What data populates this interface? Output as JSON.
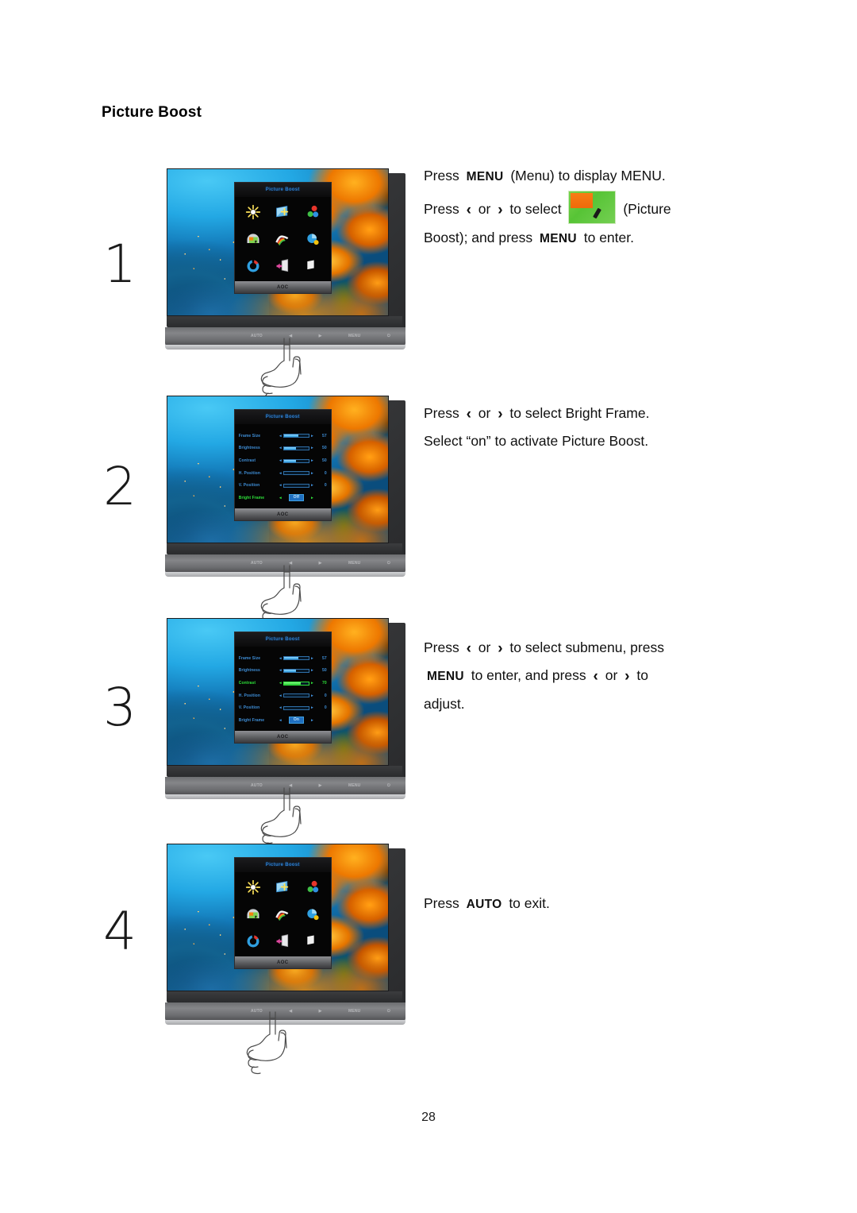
{
  "document": {
    "title": "Picture Boost",
    "page_number": "28"
  },
  "keys": {
    "menu": "MENU",
    "auto": "AUTO",
    "left": "‹",
    "right": "›",
    "or": "or"
  },
  "monitor": {
    "brand": "AOC",
    "osd_title": "Picture Boost",
    "button_labels": [
      "AUTO",
      "◀",
      "▶",
      "MENU",
      "⏻"
    ],
    "icons": [
      "luminance-icon",
      "image-setup-icon",
      "color-temperature-icon",
      "picture-boost-icon",
      "osd-setup-icon",
      "extra-icon",
      "reset-icon",
      "exit-icon",
      "brightness-icon"
    ]
  },
  "steps": [
    {
      "number": "1",
      "osd_mode": "grid",
      "lines": [
        [
          {
            "t": "text",
            "v": "Press "
          },
          {
            "t": "key",
            "v": "MENU"
          },
          {
            "t": "text",
            "v": " (Menu) to display MENU."
          }
        ],
        [
          {
            "t": "text",
            "v": "Press "
          },
          {
            "t": "arrow",
            "v": "‹"
          },
          {
            "t": "text",
            "v": " or "
          },
          {
            "t": "arrow",
            "v": "›"
          },
          {
            "t": "text",
            "v": " to select "
          },
          {
            "t": "icon",
            "v": "picture-boost-icon"
          },
          {
            "t": "text",
            "v": " (Picture"
          }
        ],
        [
          {
            "t": "text",
            "v": "Boost); and press "
          },
          {
            "t": "key",
            "v": "MENU"
          },
          {
            "t": "text",
            "v": " to enter."
          }
        ]
      ]
    },
    {
      "number": "2",
      "osd_mode": "list",
      "selected_row": 5,
      "lines": [
        [
          {
            "t": "text",
            "v": "Press "
          },
          {
            "t": "arrow",
            "v": "‹"
          },
          {
            "t": "text",
            "v": " or "
          },
          {
            "t": "arrow",
            "v": "›"
          },
          {
            "t": "text",
            "v": " to select Bright Frame."
          }
        ],
        [
          {
            "t": "text",
            "v": "Select “on” to activate Picture Boost."
          }
        ]
      ]
    },
    {
      "number": "3",
      "osd_mode": "list",
      "selected_row": 2,
      "lines": [
        [
          {
            "t": "text",
            "v": "Press "
          },
          {
            "t": "arrow",
            "v": "‹"
          },
          {
            "t": "text",
            "v": " or "
          },
          {
            "t": "arrow",
            "v": "›"
          },
          {
            "t": "text",
            "v": " to select submenu, press"
          }
        ],
        [
          {
            "t": "key",
            "v": "MENU"
          },
          {
            "t": "text",
            "v": " to enter, and press "
          },
          {
            "t": "arrow",
            "v": "‹"
          },
          {
            "t": "text",
            "v": " or "
          },
          {
            "t": "arrow",
            "v": "›"
          },
          {
            "t": "text",
            "v": " to"
          }
        ],
        [
          {
            "t": "text",
            "v": "adjust."
          }
        ]
      ]
    },
    {
      "number": "4",
      "osd_mode": "grid",
      "lines": [
        [
          {
            "t": "text",
            "v": "Press "
          },
          {
            "t": "key",
            "v": "AUTO"
          },
          {
            "t": "text",
            "v": " to exit."
          }
        ]
      ]
    }
  ],
  "osd_submenu": {
    "rows": [
      {
        "label": "Frame Size",
        "value": "57",
        "type": "bar",
        "percent": 57
      },
      {
        "label": "Brightness",
        "value": "50",
        "type": "bar",
        "percent": 50
      },
      {
        "label": "Contrast",
        "value": "50",
        "type": "bar",
        "percent": 50
      },
      {
        "label": "H. Position",
        "value": "0",
        "type": "bar",
        "percent": 0
      },
      {
        "label": "V. Position",
        "value": "0",
        "type": "bar",
        "percent": 0
      },
      {
        "label": "Bright Frame",
        "value": "Off",
        "type": "toggle"
      }
    ],
    "rows_step3": [
      {
        "label": "Frame Size",
        "value": "57",
        "type": "bar",
        "percent": 57
      },
      {
        "label": "Brightness",
        "value": "50",
        "type": "bar",
        "percent": 50
      },
      {
        "label": "Contrast",
        "value": "70",
        "type": "bar",
        "percent": 70
      },
      {
        "label": "H. Position",
        "value": "0",
        "type": "bar",
        "percent": 0
      },
      {
        "label": "V. Position",
        "value": "0",
        "type": "bar",
        "percent": 0
      },
      {
        "label": "Bright Frame",
        "value": "On",
        "type": "toggle"
      }
    ]
  }
}
